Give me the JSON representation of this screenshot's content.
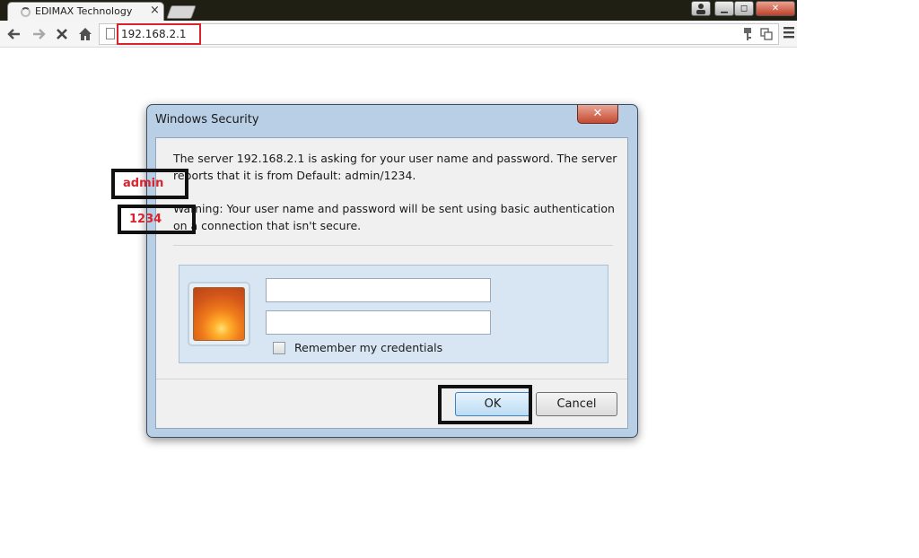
{
  "browser": {
    "tab_title": "EDIMAX Technology",
    "tab_close": "×",
    "url": "192.168.2.1",
    "window_controls": {
      "minimize": "▁",
      "maximize": "◻",
      "close": "✕"
    }
  },
  "dialog": {
    "title": "Windows Security",
    "close_glyph": "✕",
    "message_server": "The server 192.168.2.1 is asking for your user name and password. The server reports that it is from Default: admin/1234.",
    "message_warning": "Warning: Your user name and password will be sent using basic authentication on a connection that isn't secure.",
    "username_value": "admin",
    "password_value": "1234",
    "remember_label": "Remember my credentials",
    "remember_checked": false,
    "ok_label": "OK",
    "cancel_label": "Cancel"
  },
  "icons": {
    "back": "back-arrow-icon",
    "forward": "forward-arrow-icon",
    "stop": "stop-icon",
    "home": "home-icon",
    "page": "page-icon",
    "key": "key-icon",
    "translate": "translate-icon",
    "menu": "menu-icon",
    "user_tile": "user-tile-flower-icon"
  },
  "colors": {
    "annotation_red": "#d8242e",
    "annotation_black": "#111111",
    "dialog_frame": "#b9cfe5"
  }
}
